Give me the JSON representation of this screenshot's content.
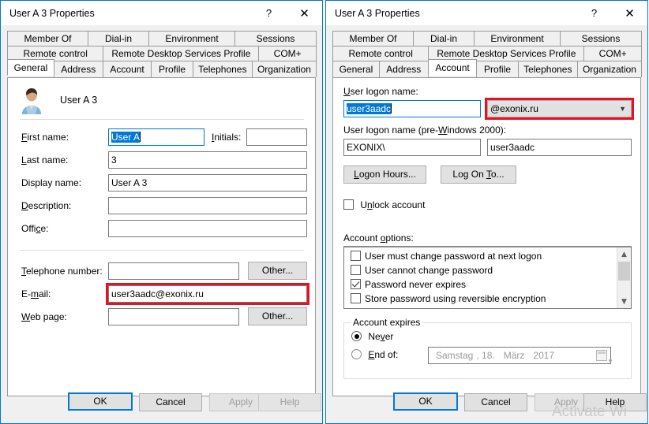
{
  "left_dialog": {
    "title": "User A 3 Properties",
    "titlebar": {
      "help_glyph": "?",
      "close_glyph": "✕"
    },
    "tabs_row1": [
      "Member Of",
      "Dial-in",
      "Environment",
      "Sessions"
    ],
    "tabs_row2": [
      "Remote control",
      "Remote Desktop Services Profile",
      "COM+"
    ],
    "tabs_row3": [
      "General",
      "Address",
      "Account",
      "Profile",
      "Telephones",
      "Organization"
    ],
    "selected_tab": "General",
    "header_name": "User A 3",
    "fields": {
      "first_name_label": "First name:",
      "first_name_value": "User A",
      "initials_label": "Initials:",
      "initials_value": "",
      "last_name_label": "Last name:",
      "last_name_value": "3",
      "display_name_label": "Display name:",
      "display_name_value": "User A 3",
      "description_label": "Description:",
      "description_value": "",
      "office_label": "Office:",
      "office_value": "",
      "telephone_label": "Telephone number:",
      "telephone_value": "",
      "telephone_other": "Other...",
      "email_label": "E-mail:",
      "email_value": "user3aadc@exonix.ru",
      "webpage_label": "Web page:",
      "webpage_value": "",
      "webpage_other": "Other..."
    },
    "footer": {
      "ok": "OK",
      "cancel": "Cancel",
      "apply": "Apply",
      "help": "Help"
    }
  },
  "right_dialog": {
    "title": "User A 3 Properties",
    "titlebar": {
      "help_glyph": "?",
      "close_glyph": "✕"
    },
    "tabs_row1": [
      "Member Of",
      "Dial-in",
      "Environment",
      "Sessions"
    ],
    "tabs_row2": [
      "Remote control",
      "Remote Desktop Services Profile",
      "COM+"
    ],
    "tabs_row3": [
      "General",
      "Address",
      "Account",
      "Profile",
      "Telephones",
      "Organization"
    ],
    "selected_tab": "Account",
    "fields": {
      "logon_name_label": "User logon name:",
      "logon_name_value": "user3aadc",
      "upn_suffix_value": "@exonix.ru",
      "pre2000_label": "User logon name (pre-Windows 2000):",
      "pre2000_domain": "EXONIX\\",
      "pre2000_value": "user3aadc",
      "logon_hours_button": "Logon Hours...",
      "logon_to_button": "Log On To...",
      "unlock_label": "Unlock account",
      "unlock_checked": false,
      "account_options_label": "Account options:"
    },
    "account_options": [
      {
        "label": "User must change password at next logon",
        "checked": false
      },
      {
        "label": "User cannot change password",
        "checked": false
      },
      {
        "label": "Password never expires",
        "checked": true
      },
      {
        "label": "Store password using reversible encryption",
        "checked": false
      }
    ],
    "account_expires": {
      "group_title": "Account expires",
      "never_label": "Never",
      "never_selected": true,
      "end_of_label": "End of:",
      "end_of_selected": false,
      "date_weekday": "Samstag",
      "date_sep": ", 18.",
      "date_month": "März",
      "date_year": "2017"
    },
    "footer": {
      "ok": "OK",
      "cancel": "Cancel",
      "apply": "Apply",
      "help": "Help"
    }
  },
  "watermark": {
    "text": "Activate Wi"
  },
  "colors": {
    "accent": "#0078d7",
    "highlight_red": "#e81123",
    "dialog_bg": "#f0f0f0",
    "page_bg": "#ffffff"
  }
}
